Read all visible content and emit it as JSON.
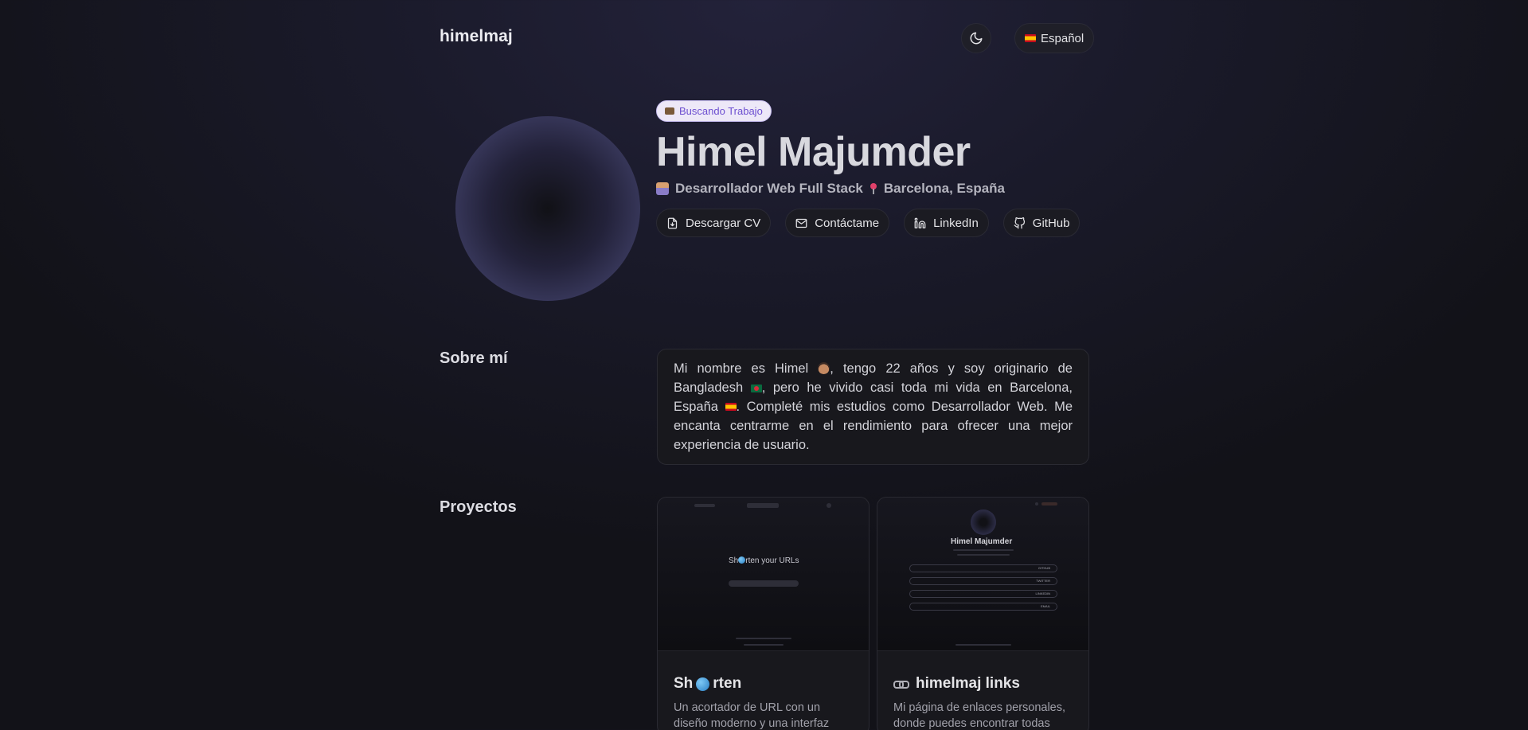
{
  "header": {
    "brand": "himelmaj",
    "language_label": "Español"
  },
  "hero": {
    "badge": "Buscando Trabajo",
    "name": "Himel Majumder",
    "role": "Desarrollador Web Full Stack",
    "location": "Barcelona, España",
    "actions": [
      {
        "label": "Descargar CV",
        "icon": "file-download-icon"
      },
      {
        "label": "Contáctame",
        "icon": "mail-icon"
      },
      {
        "label": "LinkedIn",
        "icon": "linkedin-icon"
      },
      {
        "label": "GitHub",
        "icon": "github-icon"
      }
    ]
  },
  "about": {
    "title": "Sobre mí",
    "text_1": "Mi nombre es Himel",
    "text_2": ", tengo 22 años y soy originario de Bangladesh",
    "text_3": ", pero he vivido casi toda mi vida en Barcelona, España",
    "text_4": ". Completé mis estudios como Desarrollador Web. Me encanta centrarme en el rendimiento para ofrecer una mejor experiencia de usuario."
  },
  "projects": {
    "title": "Proyectos",
    "items": [
      {
        "title_a": "Sh",
        "title_b": "rten",
        "desc": "Un acortador de URL con un diseño moderno y una interfaz",
        "thumb_text_a": "Sh",
        "thumb_text_b": "rten your URLs"
      },
      {
        "title": "himelmaj links",
        "desc": "Mi página de enlaces personales, donde puedes encontrar todas",
        "thumb_name": "Himel Majumder",
        "thumb_rows": [
          "GITHUB",
          "TWITTER",
          "LINKEDIN",
          "EMAIL"
        ]
      }
    ]
  },
  "colors": {
    "accent": "#6d4fd0",
    "background": "#121218"
  }
}
